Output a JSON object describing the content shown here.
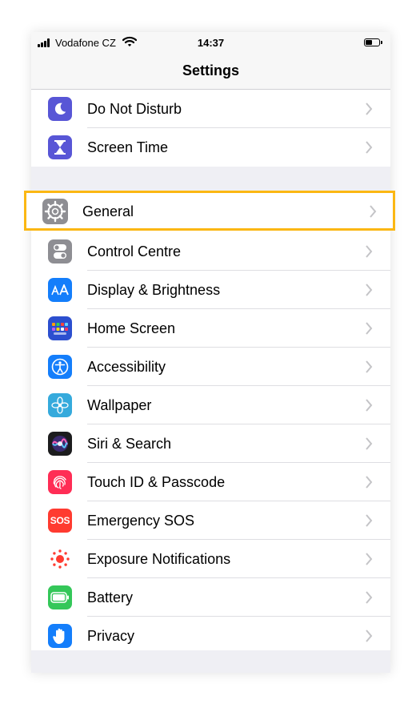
{
  "status_bar": {
    "carrier": "Vodafone CZ",
    "time": "14:37"
  },
  "nav": {
    "title": "Settings"
  },
  "groups": [
    {
      "items": [
        {
          "label": "Do Not Disturb",
          "icon": "moon-icon",
          "color": "#5856d6"
        },
        {
          "label": "Screen Time",
          "icon": "hourglass-icon",
          "color": "#5856d6"
        }
      ]
    },
    {
      "items": [
        {
          "label": "General",
          "icon": "gear-icon",
          "color": "#8e8e93",
          "highlighted": true
        },
        {
          "label": "Control Centre",
          "icon": "toggles-icon",
          "color": "#8e8e93"
        },
        {
          "label": "Display & Brightness",
          "icon": "text-size-icon",
          "color": "#147efb"
        },
        {
          "label": "Home Screen",
          "icon": "app-grid-icon",
          "color": "#2c4fcf"
        },
        {
          "label": "Accessibility",
          "icon": "accessibility-icon",
          "color": "#147efb"
        },
        {
          "label": "Wallpaper",
          "icon": "flower-icon",
          "color": "#35aadc"
        },
        {
          "label": "Siri & Search",
          "icon": "siri-icon",
          "color": "#1c1c1e"
        },
        {
          "label": "Touch ID & Passcode",
          "icon": "fingerprint-icon",
          "color": "#ff2d55"
        },
        {
          "label": "Emergency SOS",
          "icon": "sos-icon",
          "color": "#ff3b30",
          "icon_text": "SOS"
        },
        {
          "label": "Exposure Notifications",
          "icon": "exposure-icon",
          "color": "#ffffff"
        },
        {
          "label": "Battery",
          "icon": "battery-icon",
          "color": "#34c759"
        },
        {
          "label": "Privacy",
          "icon": "hand-icon",
          "color": "#147efb"
        }
      ]
    }
  ],
  "highlight_color": "#fbb713"
}
